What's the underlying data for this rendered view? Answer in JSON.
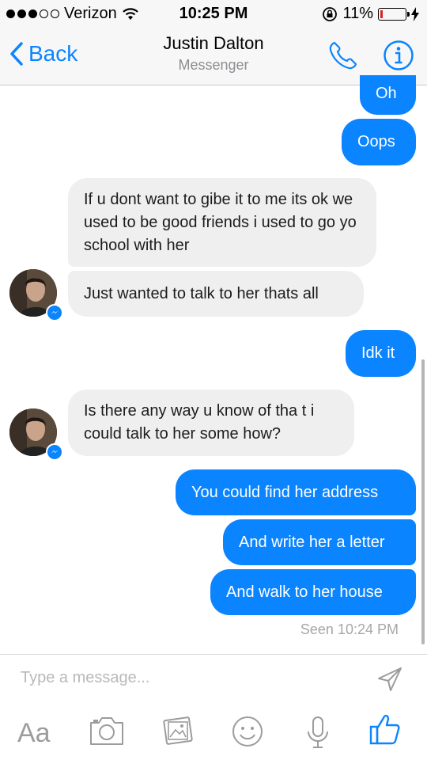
{
  "status_bar": {
    "carrier": "Verizon",
    "time": "10:25 PM",
    "battery": "11%",
    "battery_level": 0.11
  },
  "nav": {
    "back_label": "Back",
    "title": "Justin Dalton",
    "subtitle": "Messenger"
  },
  "messages": [
    {
      "from": "me",
      "text": "Oh"
    },
    {
      "from": "me",
      "text": "Oops"
    },
    {
      "from": "them",
      "text": "If u dont want to gibe it to me its ok we used to be good friends i used to go yo school with her"
    },
    {
      "from": "them",
      "text": "Just wanted to talk to her thats all"
    },
    {
      "from": "me",
      "text": "Idk it"
    },
    {
      "from": "them",
      "text": "Is there any way u know of tha t i could talk to her some how?"
    },
    {
      "from": "me",
      "text": "You could find her address"
    },
    {
      "from": "me",
      "text": "And write her a letter"
    },
    {
      "from": "me",
      "text": "And walk to her house"
    }
  ],
  "seen_status": "Seen 10:24 PM",
  "composer": {
    "placeholder": "Type a message...",
    "text_tool_label": "Aa"
  },
  "colors": {
    "accent": "#0b84ff",
    "incoming_bubble": "#efefef",
    "battery_low": "#e02020"
  }
}
